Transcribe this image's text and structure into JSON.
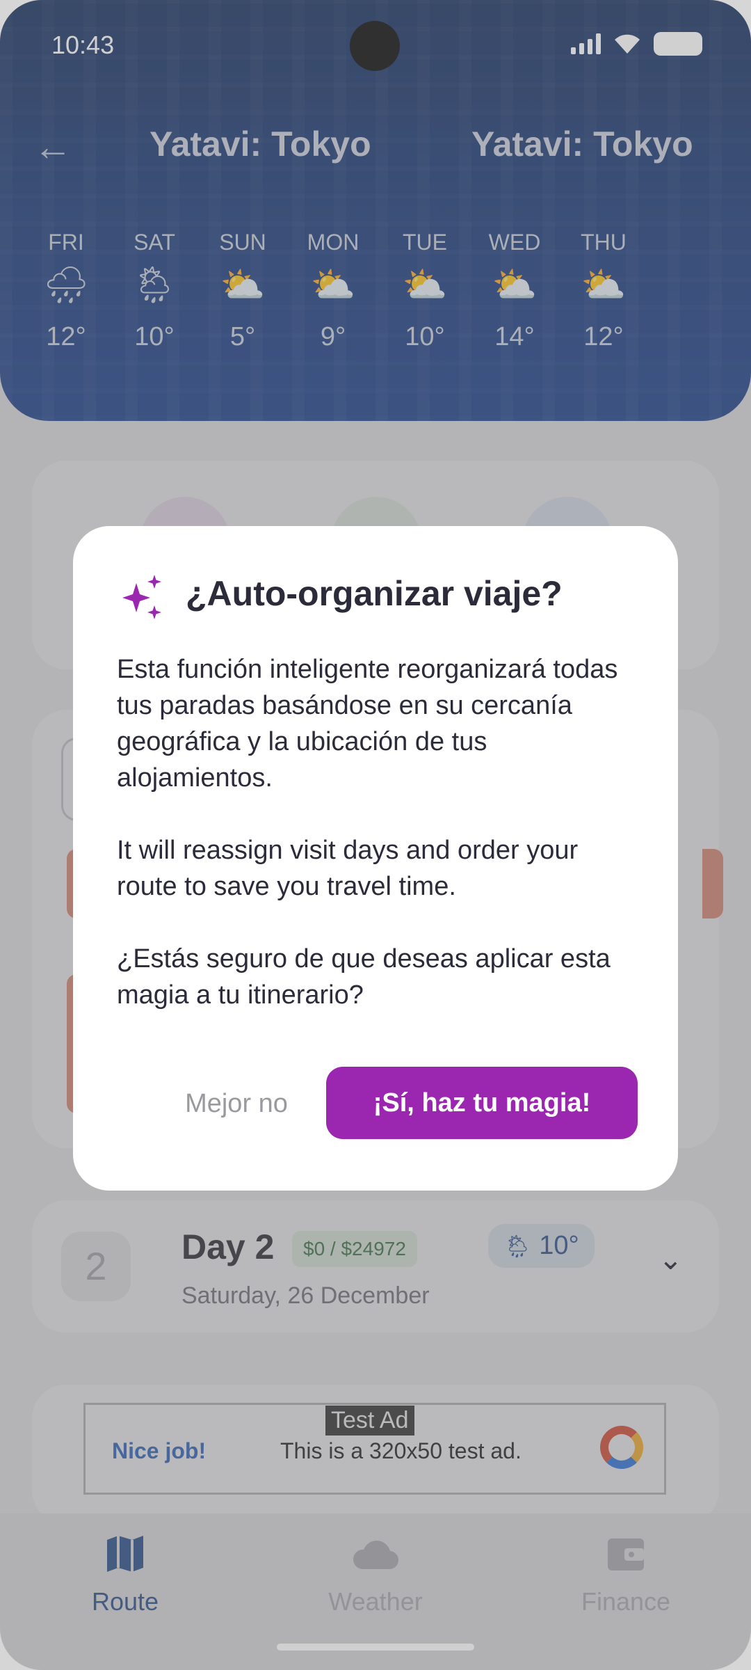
{
  "status": {
    "time": "10:43"
  },
  "header": {
    "title_left": "Yatavi: Tokyo",
    "title_right": "Yatavi: Tokyo",
    "forecast": [
      {
        "day": "FRI",
        "icon": "rain-cloud-icon",
        "glyph": "🌧",
        "temp": "12°"
      },
      {
        "day": "SAT",
        "icon": "sun-rain-icon",
        "glyph": "🌦",
        "temp": "10°"
      },
      {
        "day": "SUN",
        "icon": "partly-cloudy-icon",
        "glyph": "⛅",
        "temp": "5°"
      },
      {
        "day": "MON",
        "icon": "partly-cloudy-icon",
        "glyph": "⛅",
        "temp": "9°"
      },
      {
        "day": "TUE",
        "icon": "partly-cloudy-icon",
        "glyph": "⛅",
        "temp": "10°"
      },
      {
        "day": "WED",
        "icon": "partly-cloudy-icon",
        "glyph": "⛅",
        "temp": "14°"
      },
      {
        "day": "THU",
        "icon": "partly-cloudy-icon",
        "glyph": "⛅",
        "temp": "12°"
      }
    ]
  },
  "day2": {
    "number": "2",
    "title": "Day 2",
    "budget": "$0 / $24972",
    "weather_temp": "10°",
    "date": "Saturday, 26 December"
  },
  "ad": {
    "tag": "Test Ad",
    "headline": "Nice job!",
    "text": "This is a 320x50 test ad."
  },
  "nav": {
    "route": "Route",
    "weather": "Weather",
    "finance": "Finance"
  },
  "dialog": {
    "title": "¿Auto-organizar viaje?",
    "p1": "Esta función inteligente reorganizará todas tus paradas basándose en su cercanía geográfica y la ubicación de tus alojamientos.",
    "p2": "It will reassign visit days and order your route to save you travel time.",
    "p3": "¿Estás seguro de que deseas aplicar esta magia a tu itinerario?",
    "cancel": "Mejor no",
    "confirm": "¡Sí, haz tu magia!"
  },
  "colors": {
    "accent": "#9b27b0",
    "header": "#1b3a78"
  }
}
